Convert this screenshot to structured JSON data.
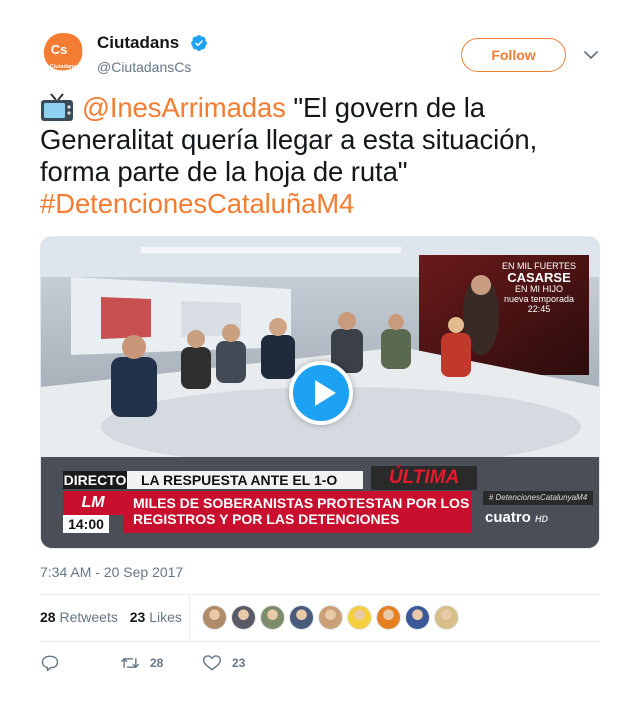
{
  "account": {
    "display_name": "Ciutadans",
    "handle": "@CiutadansCs",
    "avatar_text": "Cs",
    "avatar_subtext": "Ciutadans",
    "verified": true,
    "accent_color": "#f47c33"
  },
  "follow_label": "Follow",
  "tweet": {
    "emoji_icon": "tv-icon",
    "mention": "@InesArrimadas",
    "quote": " \"El govern de la Generalitat quería llegar a esta situación, forma parte de la hoja de ruta\"",
    "hashtag": "#DetencionesCataluñaM4"
  },
  "video": {
    "overlay_directo": "DIRECTO",
    "overlay_headline": "LA RESPUESTA ANTE EL 1-O",
    "overlay_ultima": "ÚLTIMA HORA",
    "overlay_logo": "LM",
    "overlay_ticker": "MILES DE SOBERANISTAS PROTESTAN POR LOS REGISTROS Y POR LAS DETENCIONES",
    "overlay_time": "14:00",
    "overlay_hashtag": "# DetencionesCatalunyaM4",
    "overlay_channel": "cuatro",
    "overlay_channel_hd": "HD",
    "screen_line1": "EN MIL FUERTES",
    "screen_line2": "CASARSE",
    "screen_line3": "EN MI HIJO",
    "screen_line4": "nueva temporada",
    "screen_line5": "22:45",
    "play_icon": "play-icon"
  },
  "timestamp": "7:34 AM - 20 Sep 2017",
  "stats": {
    "retweets_count": "28",
    "retweets_label": "Retweets",
    "likes_count": "23",
    "likes_label": "Likes"
  },
  "likers": [
    {
      "name": "liker-avatar-1",
      "color": "#b08b6a"
    },
    {
      "name": "liker-avatar-2",
      "color": "#5a5a66"
    },
    {
      "name": "liker-avatar-3",
      "color": "#7d8c6a"
    },
    {
      "name": "liker-avatar-4",
      "color": "#4a5a7a"
    },
    {
      "name": "liker-avatar-5",
      "color": "#c9a078"
    },
    {
      "name": "liker-avatar-6",
      "color": "#f4d03f"
    },
    {
      "name": "liker-avatar-7",
      "color": "#e67e22"
    },
    {
      "name": "liker-avatar-8",
      "color": "#3b5998"
    },
    {
      "name": "liker-avatar-9",
      "color": "#d8c08a"
    }
  ],
  "actions": {
    "reply_icon": "reply-icon",
    "retweet_icon": "retweet-icon",
    "retweet_count": "28",
    "like_icon": "heart-icon",
    "like_count": "23"
  }
}
